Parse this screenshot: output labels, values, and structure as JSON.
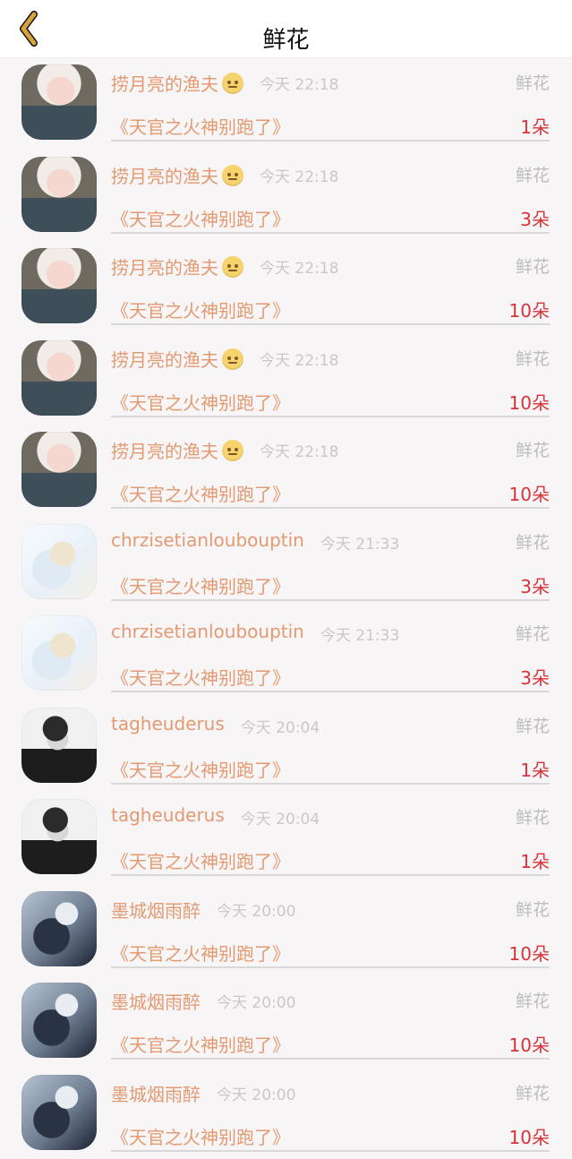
{
  "header": {
    "title": "鲜花",
    "back_icon": "chevron-left-icon",
    "accent_color": "#d6a23a"
  },
  "rows": [
    {
      "name": "捞月亮的渔夫",
      "has_emoji": true,
      "time": "今天 22:18",
      "label": "鲜花",
      "book": "《天官之火神别跑了》",
      "count": "1朵",
      "avatar_style": "a1"
    },
    {
      "name": "捞月亮的渔夫",
      "has_emoji": true,
      "time": "今天 22:18",
      "label": "鲜花",
      "book": "《天官之火神别跑了》",
      "count": "3朵",
      "avatar_style": "a1"
    },
    {
      "name": "捞月亮的渔夫",
      "has_emoji": true,
      "time": "今天 22:18",
      "label": "鲜花",
      "book": "《天官之火神别跑了》",
      "count": "10朵",
      "avatar_style": "a1"
    },
    {
      "name": "捞月亮的渔夫",
      "has_emoji": true,
      "time": "今天 22:18",
      "label": "鲜花",
      "book": "《天官之火神别跑了》",
      "count": "10朵",
      "avatar_style": "a1"
    },
    {
      "name": "捞月亮的渔夫",
      "has_emoji": true,
      "time": "今天 22:18",
      "label": "鲜花",
      "book": "《天官之火神别跑了》",
      "count": "10朵",
      "avatar_style": "a1"
    },
    {
      "name": "chrzisetianloubouptin",
      "has_emoji": false,
      "time": "今天 21:33",
      "label": "鲜花",
      "book": "《天官之火神别跑了》",
      "count": "3朵",
      "avatar_style": "a2"
    },
    {
      "name": "chrzisetianloubouptin",
      "has_emoji": false,
      "time": "今天 21:33",
      "label": "鲜花",
      "book": "《天官之火神别跑了》",
      "count": "3朵",
      "avatar_style": "a2"
    },
    {
      "name": "tagheuderus",
      "has_emoji": false,
      "time": "今天 20:04",
      "label": "鲜花",
      "book": "《天官之火神别跑了》",
      "count": "1朵",
      "avatar_style": "a3"
    },
    {
      "name": "tagheuderus",
      "has_emoji": false,
      "time": "今天 20:04",
      "label": "鲜花",
      "book": "《天官之火神别跑了》",
      "count": "1朵",
      "avatar_style": "a3"
    },
    {
      "name": "墨城烟雨醉",
      "has_emoji": false,
      "time": "今天 20:00",
      "label": "鲜花",
      "book": "《天官之火神别跑了》",
      "count": "10朵",
      "avatar_style": "a4"
    },
    {
      "name": "墨城烟雨醉",
      "has_emoji": false,
      "time": "今天 20:00",
      "label": "鲜花",
      "book": "《天官之火神别跑了》",
      "count": "10朵",
      "avatar_style": "a4"
    },
    {
      "name": "墨城烟雨醉",
      "has_emoji": false,
      "time": "今天 20:00",
      "label": "鲜花",
      "book": "《天官之火神别跑了》",
      "count": "10朵",
      "avatar_style": "a4"
    }
  ]
}
